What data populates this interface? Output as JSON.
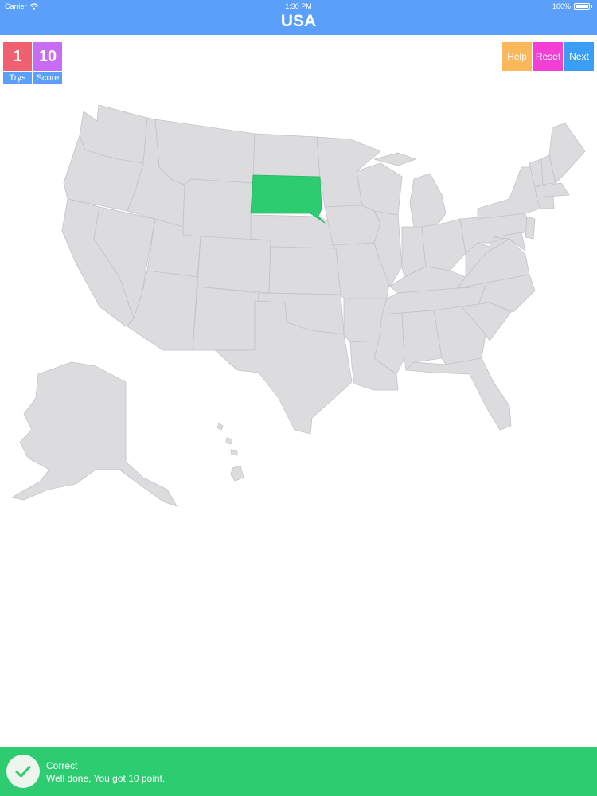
{
  "status_bar": {
    "carrier": "Carrier",
    "time": "1:30 PM",
    "battery": "100%"
  },
  "title": "USA",
  "counters": {
    "trys": {
      "value": "1",
      "label": "Trys",
      "color": "#f0606e"
    },
    "score": {
      "value": "10",
      "label": "Score",
      "color": "#c86cf3"
    }
  },
  "buttons": {
    "help": {
      "label": "Help",
      "color": "#fbb85a"
    },
    "reset": {
      "label": "Reset",
      "color": "#f33fd6"
    },
    "next": {
      "label": "Next",
      "color": "#3a9ef5"
    }
  },
  "map": {
    "highlighted_state": "south-dakota",
    "highlight_color": "#2ecc71",
    "state_fill": "#dcdbdd",
    "state_stroke": "#c4c3c6"
  },
  "banner": {
    "title": "Correct",
    "message": "Well done, You got 10 point.",
    "color": "#2ecc71"
  },
  "icons": {
    "wifi": "wifi-icon",
    "battery": "battery-icon",
    "check": "checkmark-icon"
  }
}
